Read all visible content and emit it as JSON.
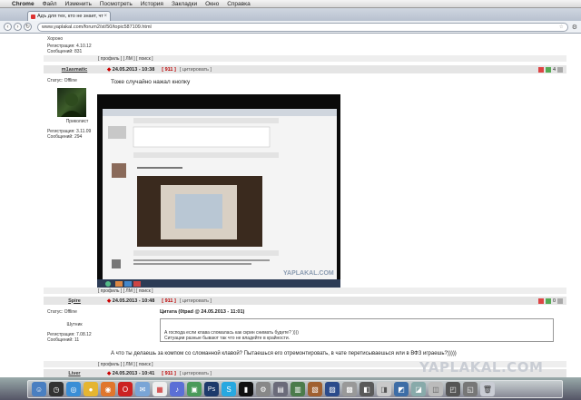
{
  "menubar": {
    "items": [
      "Chrome",
      "Файл",
      "Изменить",
      "Посмотреть",
      "История",
      "Закладки",
      "Окно",
      "Справка"
    ]
  },
  "tab": {
    "title": "Адъ для тех, кто не знает, что тако",
    "close": "×"
  },
  "toolbar": {
    "url": "www.yaplakal.com/forum2/st/50/topic587109.html",
    "back": "‹",
    "forward": "›",
    "reload": "↻",
    "star": "☆",
    "wrench": "⚙"
  },
  "prev_post": {
    "author_line": "Хороно",
    "registered": "Регистрация: 4.10.12",
    "messages": "Сообщений: 831",
    "footer": "[ профиль ] [ ЛМ ] [ поиск ]"
  },
  "post1": {
    "author": "m1asmatic",
    "date": "24.05.2013 - 10:38",
    "id": "[ 911 ]",
    "cite": "[ цитировать ]",
    "rating": "4",
    "status": "Статус: Offline",
    "rank": "Приколист",
    "registered": "Регистрация: 3.11.09",
    "messages": "Сообщений: 294",
    "text": "Тоже случайно нажал кнопку",
    "footer": "[ профиль ] [ ЛМ ] [ поиск ]",
    "screenshot_watermark": "YAPLAKAL.COM"
  },
  "post2": {
    "author": "Spire",
    "date": "24.05.2013 - 10:48",
    "id": "[ 911 ]",
    "cite": "[ цитировать ]",
    "rating": "0",
    "status": "Статус: Offline",
    "rank": "Шутник",
    "registered": "Регистрация: 7.08.12",
    "messages": "Сообщений: 11",
    "quote_header": "Цитата (0tpad @ 24.05.2013 - 11:01)",
    "quote_line1": "А господа если клава сломалась как скрин снимать будете? ))))",
    "quote_line2": "Ситуации разные бывают так что не владейте в крайности.",
    "text": "А что ты делаешь за компом со сломанной клавой? Пытаешься его отремонтировать, в чате перетисываешься или в ВФЗ играешь?)))))",
    "footer": "[ профиль ] [ ЛМ ] [ поиск ]"
  },
  "post3": {
    "author": "Liver",
    "date": "24.05.2013 - 10:41",
    "id": "[ 911 ]",
    "cite": "[ цитировать ]"
  },
  "watermark": "YAPLAKAL.COM",
  "colors": {
    "post_bar": "#e5e5e5",
    "id_red": "#b00000",
    "offline_red": "#cc0000",
    "tab_bg": "#f3f5f8"
  },
  "dock_icons": [
    "finder",
    "dashboard",
    "safari",
    "chrome",
    "firefox",
    "opera",
    "mail",
    "ical",
    "itunes",
    "iphoto",
    "photoshop",
    "skype",
    "terminal",
    "preferences",
    "trash"
  ]
}
